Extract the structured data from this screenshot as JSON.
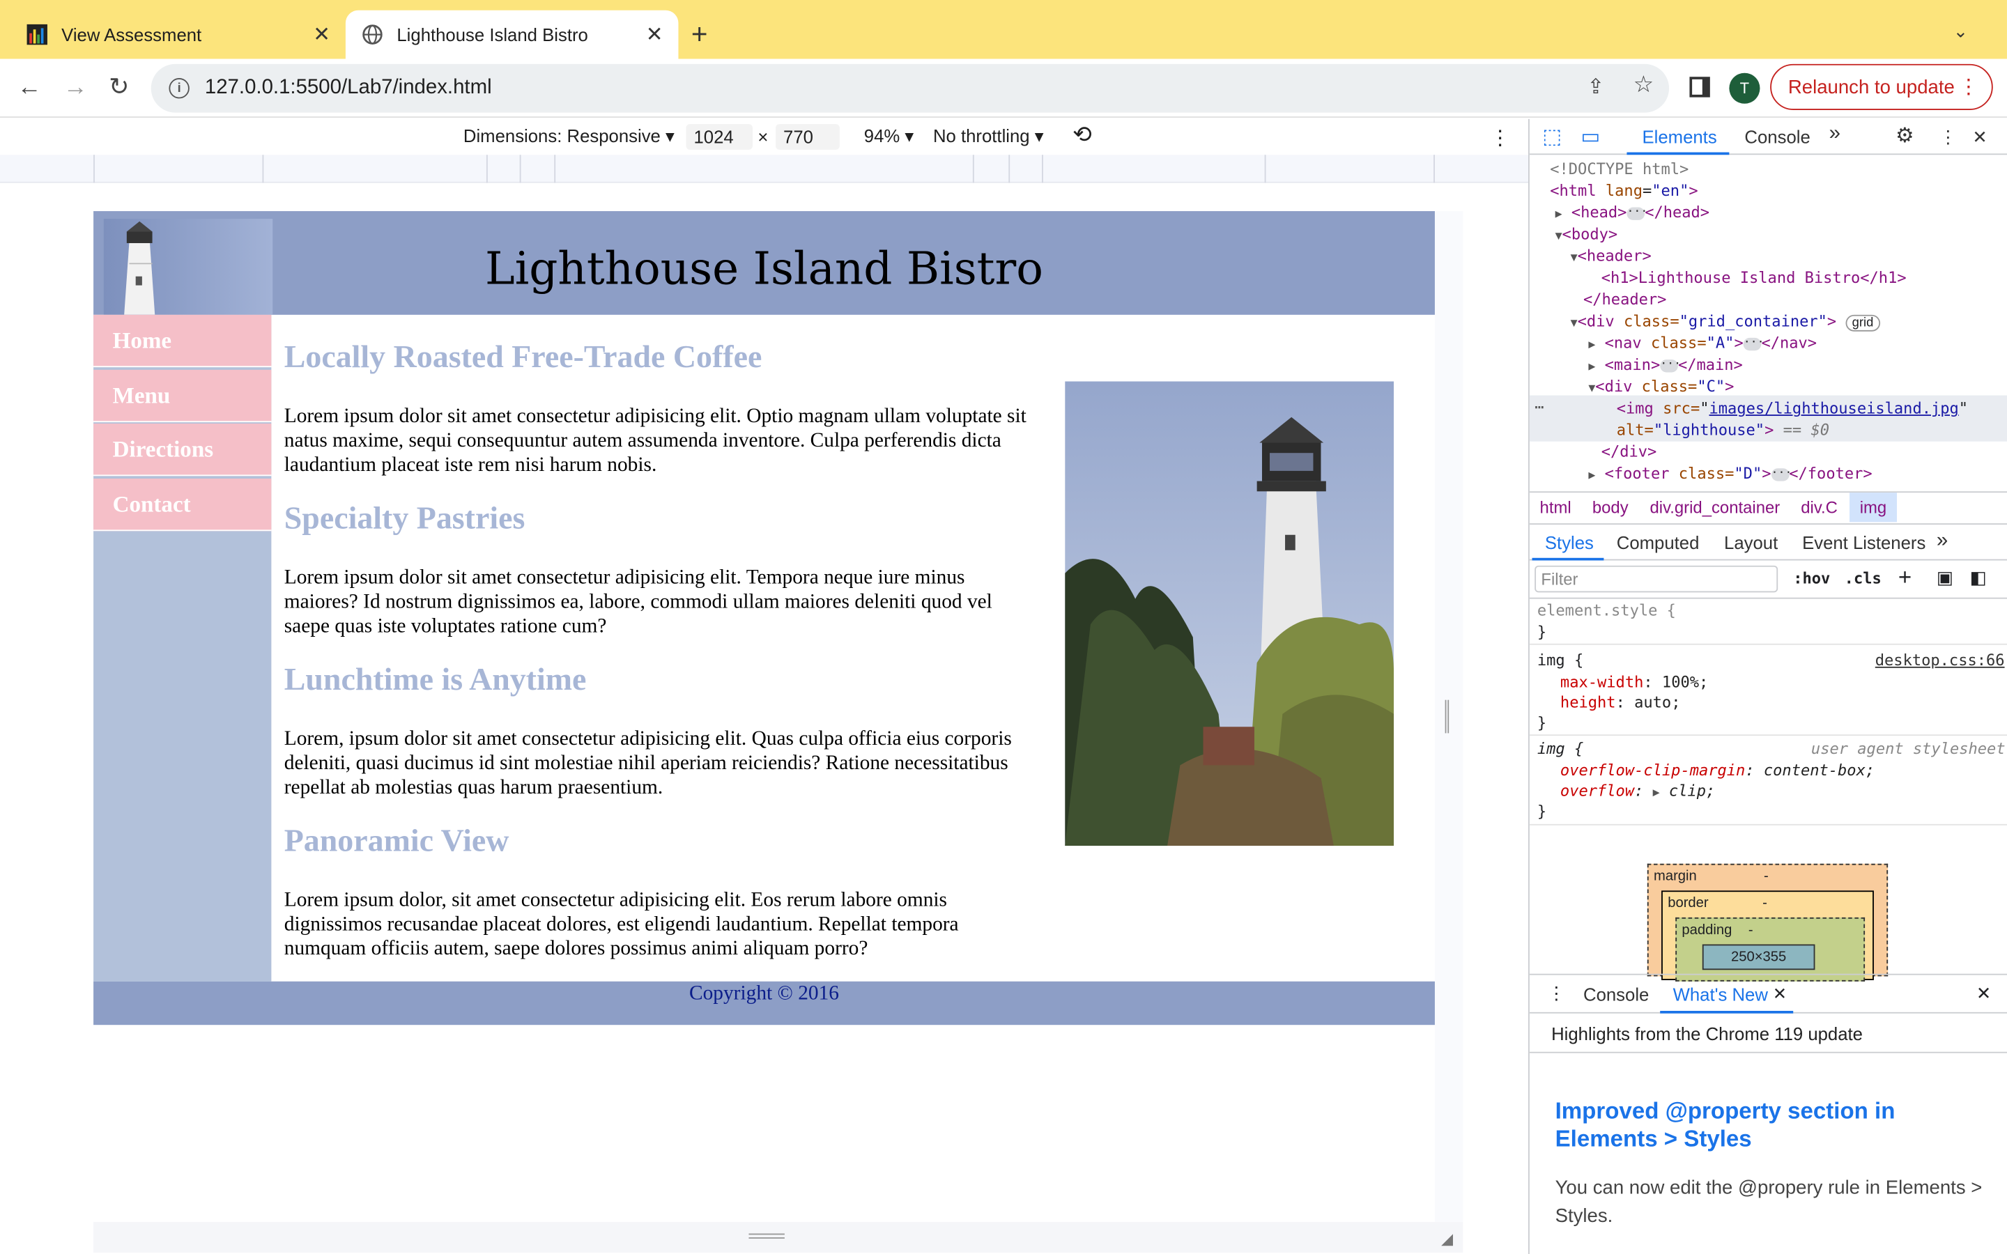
{
  "browser": {
    "tabs": [
      {
        "title": "View Assessment",
        "active": false
      },
      {
        "title": "Lighthouse Island Bistro",
        "active": true
      }
    ],
    "url": "127.0.0.1:5500/Lab7/index.html",
    "relaunch_label": "Relaunch to update",
    "avatar_initial": "T",
    "accent_color": "#fce47c"
  },
  "device_toolbar": {
    "dimensions_label": "Dimensions: Responsive",
    "width": "1024",
    "times": "×",
    "height": "770",
    "zoom": "94%",
    "throttling": "No throttling"
  },
  "site": {
    "title": "Lighthouse Island Bistro",
    "nav": [
      "Home",
      "Menu",
      "Directions",
      "Contact"
    ],
    "sections": [
      {
        "heading": "Locally Roasted Free-Trade Coffee",
        "text": "Lorem ipsum dolor sit amet consectetur adipisicing elit. Optio magnam ullam voluptate sit natus maxime, sequi consequuntur autem assumenda inventore. Culpa perferendis dicta laudantium placeat iste rem nisi harum nobis."
      },
      {
        "heading": "Specialty Pastries",
        "text": "Lorem ipsum dolor sit amet consectetur adipisicing elit. Tempora neque iure minus maiores? Id nostrum dignissimos ea, labore, commodi ullam maiores deleniti quod vel saepe quas iste voluptates ratione cum?"
      },
      {
        "heading": "Lunchtime is Anytime",
        "text": "Lorem, ipsum dolor sit amet consectetur adipisicing elit. Quas culpa officia eius corporis deleniti, quasi ducimus id sint molestiae nihil aperiam reiciendis? Ratione necessitatibus repellat ab molestias quas harum praesentium."
      },
      {
        "heading": "Panoramic View",
        "text": "Lorem ipsum dolor, sit amet consectetur adipisicing elit. Eos rerum labore omnis dignissimos recusandae placeat dolores, est eligendi laudantium. Repellat tempora numquam officiis autem, saepe dolores possimus animi aliquam porro?"
      }
    ],
    "footer": "Copyright © 2016",
    "colors": {
      "header": "#8d9ec6",
      "nav_item": "#f5bfc8",
      "nav_bg": "#b2c1da",
      "heading": "#a7b6d6"
    }
  },
  "devtools": {
    "tabs": {
      "elements": "Elements",
      "console": "Console",
      "more": "»"
    },
    "dom": {
      "doctype": "<!DOCTYPE html>",
      "html_open": "<html",
      "lang_attr": "lang",
      "lang_val": "\"en\"",
      "head": "<head>",
      "head_close": "</head>",
      "body": "<body>",
      "header": "<header>",
      "h1_line": "<h1>Lighthouse Island Bistro</h1>",
      "header_close": "</header>",
      "div_open": "<div",
      "class_attr": "class=",
      "grid_class": "\"grid_container\"",
      "grid_badge": "grid",
      "nav_open": "<nav",
      "nav_class": "\"A\"",
      "nav_close": "</nav>",
      "main_open": "<main>",
      "main_close": "</main>",
      "div_c_class": "\"C\"",
      "img_open": "<img",
      "src_attr": "src=",
      "src_val": "images/lighthouseisland.jpg",
      "alt_attr": "alt=",
      "alt_val": "\"lighthouse\"",
      "selected_marker": "== $0",
      "div_close": "</div>",
      "footer_open": "<footer",
      "footer_class": "\"D\"",
      "footer_close": "</footer>",
      "dots": "···"
    },
    "breadcrumbs": [
      "html",
      "body",
      "div.grid_container",
      "div.C",
      "img"
    ],
    "subtabs": [
      "Styles",
      "Computed",
      "Layout",
      "Event Listeners"
    ],
    "filter_placeholder": "Filter",
    "hov": ":hov",
    "cls": ".cls",
    "rules": {
      "element_style": "element.style {",
      "close": "}",
      "img_selector": "img {",
      "source": "desktop.css:66",
      "max_width_prop": "max-width",
      "max_width_val": "100%;",
      "height_prop": "height",
      "height_val": "auto;",
      "ua_label": "user agent stylesheet",
      "ocm_prop": "overflow-clip-margin",
      "ocm_val": "content-box;",
      "overflow_prop": "overflow",
      "overflow_val": "clip;"
    },
    "box_model": {
      "margin": "margin",
      "border": "border",
      "padding": "padding",
      "dash": "-",
      "content": "250×355"
    },
    "drawer": {
      "console": "Console",
      "whats_new": "What's New",
      "subtitle": "Highlights from the Chrome 119 update",
      "title": "Improved @property section in Elements > Styles",
      "body": "You can now edit the @propery rule in Elements > Styles."
    }
  }
}
